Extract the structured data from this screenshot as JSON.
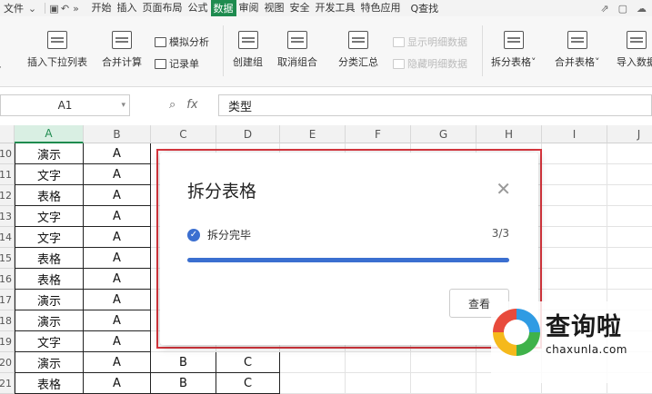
{
  "menu": {
    "file": "文件",
    "items": [
      "开始",
      "插入",
      "页面布局",
      "公式",
      "数据",
      "审阅",
      "视图",
      "安全",
      "开发工具",
      "特色应用"
    ],
    "active": "数据",
    "search": "Q查找"
  },
  "ribbon": {
    "dropdown_list": "插入下拉列表",
    "consolidate": "合并计算",
    "what_if": "模拟分析",
    "record_form": "记录单",
    "group": "创建组",
    "ungroup": "取消组合",
    "subtotal": "分类汇总",
    "show_detail": "显示明细数据",
    "hide_detail": "隐藏明细数据",
    "split_table": "拆分表格",
    "merge_table": "合并表格",
    "import_data": "导入数据"
  },
  "formula_bar": {
    "name_box": "A1",
    "fx": "fx",
    "content": "类型"
  },
  "grid": {
    "columns": [
      "A",
      "B",
      "C",
      "D",
      "E",
      "F",
      "G",
      "H",
      "I",
      "J"
    ],
    "selected_column": "A",
    "rows": [
      {
        "num": "10",
        "a": "演示",
        "b": "A",
        "c": "",
        "d": ""
      },
      {
        "num": "11",
        "a": "文字",
        "b": "A",
        "c": "",
        "d": ""
      },
      {
        "num": "12",
        "a": "表格",
        "b": "A",
        "c": "",
        "d": ""
      },
      {
        "num": "13",
        "a": "文字",
        "b": "A",
        "c": "",
        "d": ""
      },
      {
        "num": "14",
        "a": "文字",
        "b": "A",
        "c": "",
        "d": ""
      },
      {
        "num": "15",
        "a": "表格",
        "b": "A",
        "c": "",
        "d": ""
      },
      {
        "num": "16",
        "a": "表格",
        "b": "A",
        "c": "",
        "d": ""
      },
      {
        "num": "17",
        "a": "演示",
        "b": "A",
        "c": "",
        "d": ""
      },
      {
        "num": "18",
        "a": "演示",
        "b": "A",
        "c": "",
        "d": ""
      },
      {
        "num": "19",
        "a": "文字",
        "b": "A",
        "c": "",
        "d": ""
      },
      {
        "num": "20",
        "a": "演示",
        "b": "A",
        "c": "B",
        "d": "C"
      },
      {
        "num": "21",
        "a": "表格",
        "b": "A",
        "c": "B",
        "d": "C"
      }
    ]
  },
  "dialog": {
    "title": "拆分表格",
    "status": "拆分完毕",
    "count": "3/3",
    "progress": 1.0,
    "view_button": "查看",
    "accent": "#3b6fd0"
  },
  "watermark": {
    "name": "查询啦",
    "url": "chaxunla.com"
  }
}
